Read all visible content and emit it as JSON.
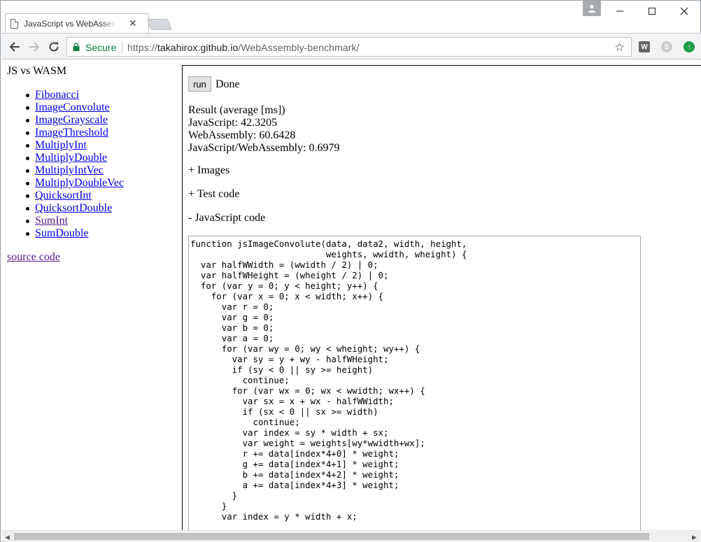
{
  "browser": {
    "tab_title": "JavaScript vs WebAssembly",
    "tab_close": "✕",
    "secure_label": "Secure",
    "url_scheme": "https://",
    "url_host": "takahirox.github.io",
    "url_path": "/WebAssembly-benchmark/",
    "extensions": [
      "W",
      "S",
      "↑"
    ],
    "window_controls": {
      "minimize": "—",
      "maximize": "☐",
      "close": "✕"
    }
  },
  "sidebar": {
    "title": "JS vs WASM",
    "items": [
      {
        "label": "Fibonacci"
      },
      {
        "label": "ImageConvolute"
      },
      {
        "label": "ImageGrayscale"
      },
      {
        "label": "ImageThreshold"
      },
      {
        "label": "MultiplyInt"
      },
      {
        "label": "MultiplyDouble"
      },
      {
        "label": "MultiplyIntVec"
      },
      {
        "label": "MultiplyDoubleVec"
      },
      {
        "label": "QuicksortInt"
      },
      {
        "label": "QuicksortDouble"
      },
      {
        "label": "SumInt"
      },
      {
        "label": "SumDouble"
      }
    ],
    "source_link": "source code"
  },
  "main": {
    "run_label": "run",
    "status": "Done",
    "result_heading": "Result (average [ms])",
    "javascript_result": "JavaScript: 42.3205",
    "wasm_result": "WebAssembly: 60.6428",
    "ratio_result": "JavaScript/WebAssembly: 0.6979",
    "images_toggle": "+ Images",
    "test_code_toggle": "+ Test code",
    "js_code_toggle": "- JavaScript code",
    "js_code": "function jsImageConvolute(data, data2, width, height,\n                          weights, wwidth, wheight) {\n  var halfWWidth = (wwidth / 2) | 0;\n  var halfWHeight = (wheight / 2) | 0;\n  for (var y = 0; y < height; y++) {\n    for (var x = 0; x < width; x++) {\n      var r = 0;\n      var g = 0;\n      var b = 0;\n      var a = 0;\n      for (var wy = 0; wy < wheight; wy++) {\n        var sy = y + wy - halfWHeight;\n        if (sy < 0 || sy >= height)\n          continue;\n        for (var wx = 0; wx < wwidth; wx++) {\n          var sx = x + wx - halfWWidth;\n          if (sx < 0 || sx >= width)\n            continue;\n          var index = sy * width + sx;\n          var weight = weights[wy*wwidth+wx];\n          r += data[index*4+0] * weight;\n          g += data[index*4+1] * weight;\n          b += data[index*4+2] * weight;\n          a += data[index*4+3] * weight;\n        }\n      }\n      var index = y * width + x;"
  }
}
